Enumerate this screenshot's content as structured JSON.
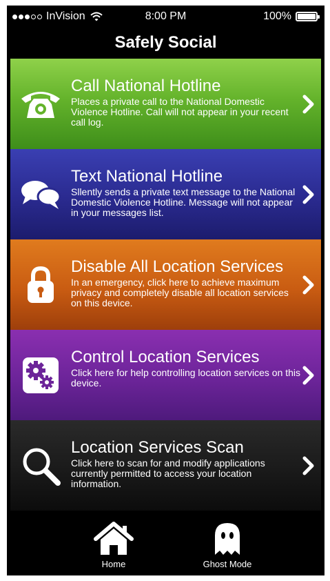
{
  "status_bar": {
    "carrier": "InVision",
    "time": "8:00 PM",
    "battery": "100%"
  },
  "header": {
    "title": "Safely Social"
  },
  "menu": [
    {
      "title": "Call National Hotline",
      "description": "Places a private call to the National Domestic Violence Hotline. Call will not appear in your recent call log.",
      "icon": "phone-icon",
      "color": "#64b32b"
    },
    {
      "title": "Text National Hotline",
      "description": "Sllently sends a private text message to the National Domestic Violence Hotline. Message will not appear in your messages list.",
      "icon": "chat-bubbles-icon",
      "color": "#2a2a8f"
    },
    {
      "title": "Disable All Location Services",
      "description": "In an emergency, click here to achieve maximum privacy and completely disable all location services on this device.",
      "icon": "lock-icon",
      "color": "#c95c12"
    },
    {
      "title": "Control Location Services",
      "description": "Click here for help controlling location services on this device.",
      "icon": "gears-icon",
      "color": "#6c2499"
    },
    {
      "title": "Location Services Scan",
      "description": "Click here to scan for and modify applications currently permitted to access your location information.",
      "icon": "magnifier-icon",
      "color": "#1a1a1a"
    }
  ],
  "tab_bar": {
    "home_label": "Home",
    "ghost_label": "Ghost Mode"
  }
}
